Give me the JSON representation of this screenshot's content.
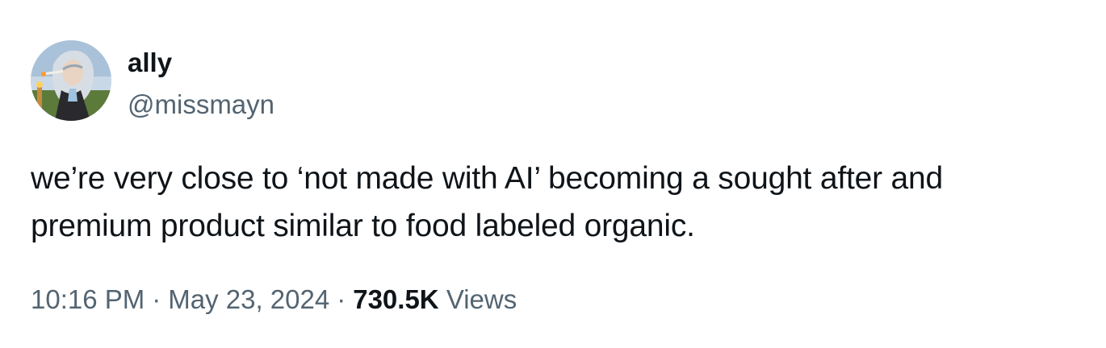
{
  "author": {
    "display_name": "ally",
    "handle": "@missmayn",
    "avatar_icon": "profile-portrait-avatar"
  },
  "tweet": {
    "text_line1": "we’re very close to ‘not made with AI’ becoming a sought after and",
    "text_line2": "premium product similar to food labeled organic."
  },
  "meta": {
    "time": "10:16 PM",
    "separator": "·",
    "date": "May 23, 2024",
    "views_count": "730.5K",
    "views_label": "Views"
  },
  "colors": {
    "text_primary": "#0f1419",
    "text_secondary": "#536471",
    "background": "#ffffff"
  }
}
